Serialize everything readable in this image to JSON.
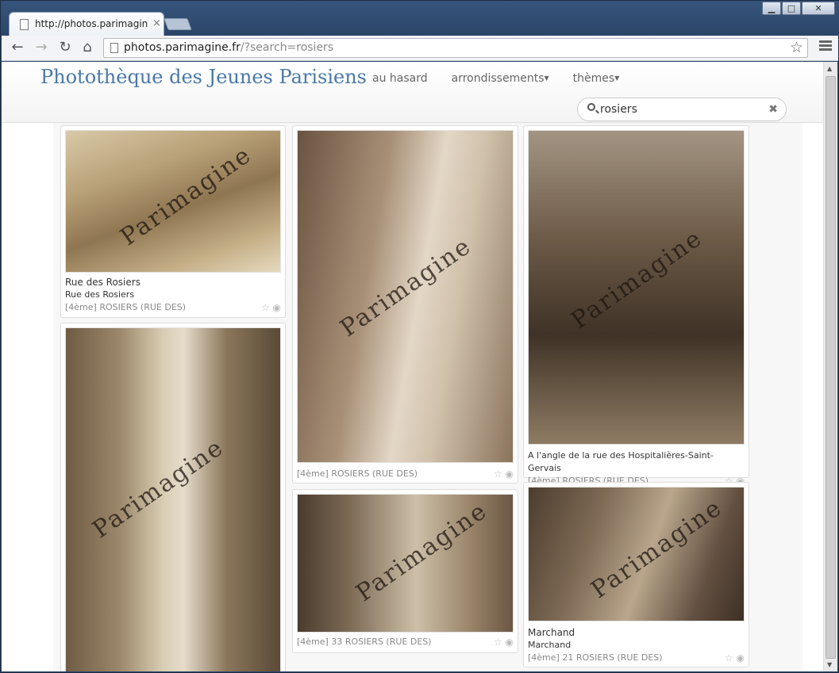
{
  "browser": {
    "tab_title": "http://photos.parimagine",
    "tab_close": "×",
    "url_host": "photos.parimagine.fr",
    "url_rest": "/?search=rosiers",
    "window_buttons": {
      "minimize": "▁",
      "maximize": "□",
      "close": "✕"
    },
    "nav_icons": [
      "back-icon",
      "forward-icon",
      "reload-icon",
      "home-icon"
    ]
  },
  "site": {
    "brand": "Photothèque des Jeunes Parisiens",
    "nav": [
      {
        "label": "au hasard",
        "dropdown": false
      },
      {
        "label": "arrondissements",
        "dropdown": true
      },
      {
        "label": "thèmes",
        "dropdown": true
      }
    ],
    "search": {
      "value": "rosiers",
      "clear": "✖"
    }
  },
  "watermark": "Parimagine",
  "cards": [
    {
      "title": "Rue des Rosiers",
      "subtitle": "Rue des Rosiers",
      "location": "[4ème] ROSIERS (RUE DES)"
    },
    {
      "title": "",
      "subtitle": "",
      "location": ""
    },
    {
      "title": "",
      "subtitle": "",
      "location": "[4ème] ROSIERS (RUE DES)"
    },
    {
      "title": "",
      "subtitle": "",
      "location": "[4ème] 33 ROSIERS (RUE DES)"
    },
    {
      "title": "A l'angle de la rue des Hospitalières-Saint-Gervais",
      "subtitle": "",
      "location": "[4ème] ROSIERS (RUE DES)"
    },
    {
      "title": "Marchand",
      "subtitle": "Marchand",
      "location": "[4ème] 21 ROSIERS (RUE DES)"
    }
  ],
  "card_icons": {
    "star": "☆",
    "globe": "◉"
  }
}
